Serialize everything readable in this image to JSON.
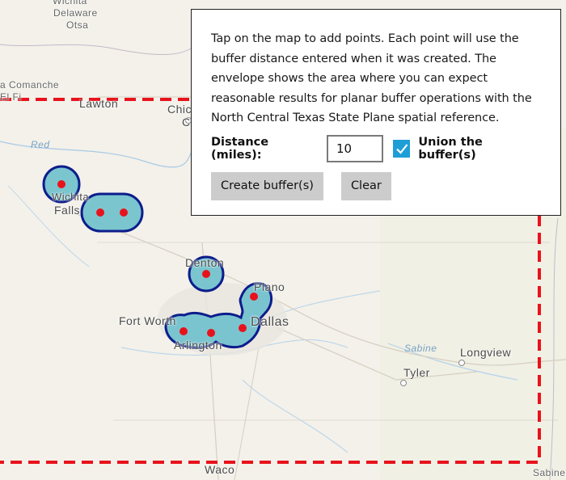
{
  "map": {
    "places": [
      {
        "name": "Wichita",
        "cls": "small"
      },
      {
        "name": "Delaware",
        "cls": "small"
      },
      {
        "name": "Otsa",
        "cls": "small"
      },
      {
        "name": "a Comanche",
        "cls": "small"
      },
      {
        "name": "El Fi",
        "cls": "small"
      },
      {
        "name": "Lawton",
        "cls": ""
      },
      {
        "name": "Chic",
        "cls": ""
      },
      {
        "name": "C",
        "cls": ""
      },
      {
        "name": "Red",
        "cls": "river"
      },
      {
        "name": "Wichita",
        "cls": ""
      },
      {
        "name": "Falls",
        "cls": ""
      },
      {
        "name": "Denton",
        "cls": ""
      },
      {
        "name": "Plano",
        "cls": ""
      },
      {
        "name": "Fort Worth",
        "cls": ""
      },
      {
        "name": "Dallas",
        "cls": ""
      },
      {
        "name": "Arlington",
        "cls": ""
      },
      {
        "name": "Sabine",
        "cls": "river"
      },
      {
        "name": "Longview",
        "cls": ""
      },
      {
        "name": "Tyler",
        "cls": ""
      },
      {
        "name": "Waco",
        "cls": ""
      },
      {
        "name": "Sabine",
        "cls": "small"
      }
    ],
    "buffer_fill": "#74c2ce",
    "buffer_stroke": "#0d1d8c",
    "point_color": "#e8121c",
    "envelope_color": "#e8121c"
  },
  "panel": {
    "instructions": "Tap on the map to add points. Each point will use the buffer distance entered when it was created. The envelope shows the area where you can expect reasonable results for planar buffer operations with the North Central Texas State Plane spatial reference.",
    "distance_label": "Distance (miles):",
    "distance_value": "10",
    "union_label": "Union the buffer(s)",
    "union_checked": true,
    "create_label": "Create buffer(s)",
    "clear_label": "Clear"
  }
}
